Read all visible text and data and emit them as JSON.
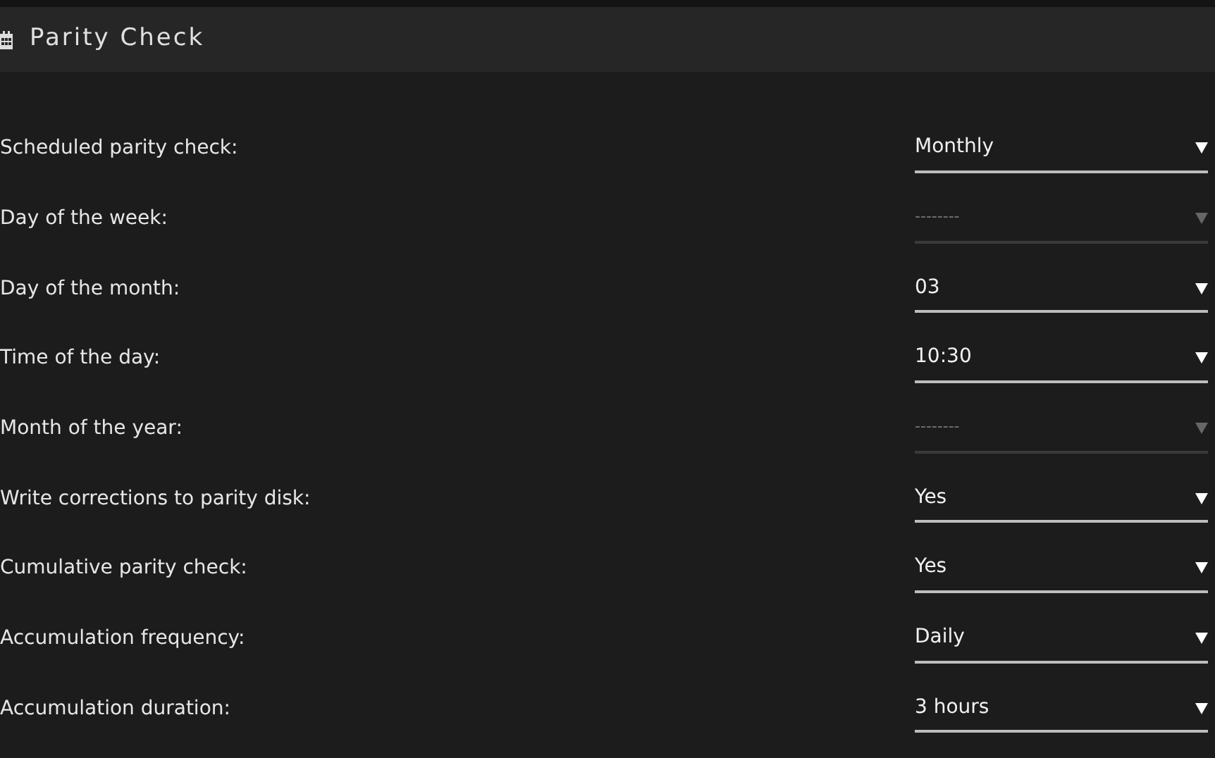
{
  "header": {
    "title": "Parity Check"
  },
  "settings": [
    {
      "label": "Scheduled parity check:",
      "value": "Monthly",
      "disabled": false
    },
    {
      "label": "Day of the week:",
      "value": "--------",
      "disabled": true
    },
    {
      "label": "Day of the month:",
      "value": "03",
      "disabled": false
    },
    {
      "label": "Time of the day:",
      "value": "10:30",
      "disabled": false
    },
    {
      "label": "Month of the year:",
      "value": "--------",
      "disabled": true
    },
    {
      "label": "Write corrections to parity disk:",
      "value": "Yes",
      "disabled": false
    },
    {
      "label": "Cumulative parity check:",
      "value": "Yes",
      "disabled": false
    },
    {
      "label": "Accumulation frequency:",
      "value": "Daily",
      "disabled": false
    },
    {
      "label": "Accumulation duration:",
      "value": "3 hours",
      "disabled": false
    }
  ]
}
